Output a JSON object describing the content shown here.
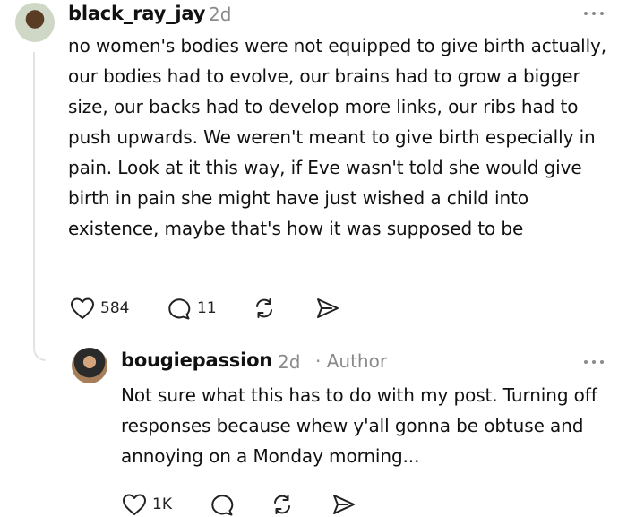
{
  "comment": {
    "username": "black_ray_jay",
    "time": "2d",
    "text": "no women's bodies were not equipped to give birth actually, our bodies had to evolve, our brains had to grow a bigger size, our backs had to develop more links, our ribs had to push upwards. We weren't meant to give birth especially in pain. Look at it this way, if Eve wasn't told she would give birth in pain she might have just wished a child into existence, maybe that's how it was supposed to be",
    "likes": "584",
    "replies": "11"
  },
  "reply": {
    "username": "bougiepassion",
    "time": "2d",
    "author_tag": "· Author",
    "text": "Not sure what this has to do with my post. Turning off responses because whew y'all gonna be obtuse and annoying on a Monday morning...",
    "likes": "1K"
  },
  "icons": {
    "like": "heart-icon",
    "reply": "speech-bubble-icon",
    "repost": "repost-icon",
    "share": "send-icon",
    "more": "more-icon"
  }
}
